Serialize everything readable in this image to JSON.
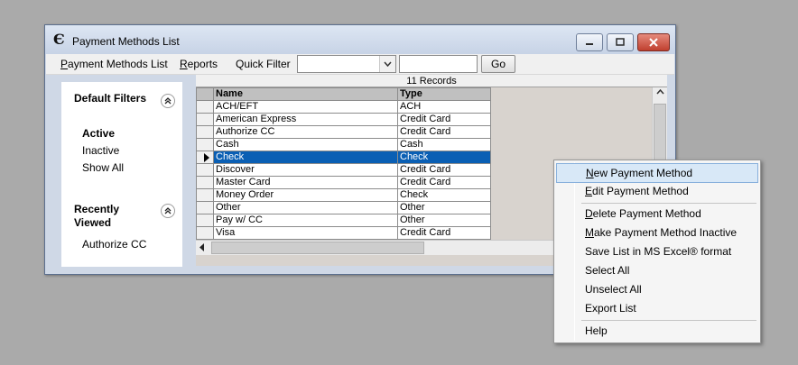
{
  "window": {
    "title": "Payment Methods List",
    "app_icon_glyph": "Є"
  },
  "menubar": {
    "items": [
      {
        "label": "Payment Methods List"
      },
      {
        "label": "Reports"
      },
      {
        "label": "Quick Filter"
      }
    ],
    "quick_filter_value": "",
    "quick_filter_text": "",
    "go_label": "Go"
  },
  "sidebar": {
    "default_filters": {
      "heading": "Default Filters",
      "items": [
        "Active",
        "Inactive",
        "Show All"
      ],
      "selected": "Active"
    },
    "recently_viewed": {
      "heading_line1": "Recently",
      "heading_line2": "Viewed",
      "items": [
        "Authorize CC"
      ]
    }
  },
  "grid": {
    "records_label": "11 Records",
    "columns": [
      "Name",
      "Type"
    ],
    "rows": [
      {
        "name": "ACH/EFT",
        "type": "ACH"
      },
      {
        "name": "American Express",
        "type": "Credit Card"
      },
      {
        "name": "Authorize CC",
        "type": "Credit Card"
      },
      {
        "name": "Cash",
        "type": "Cash"
      },
      {
        "name": "Check",
        "type": "Check"
      },
      {
        "name": "Discover",
        "type": "Credit Card"
      },
      {
        "name": "Master Card",
        "type": "Credit Card"
      },
      {
        "name": "Money Order",
        "type": "Check"
      },
      {
        "name": "Other",
        "type": "Other"
      },
      {
        "name": "Pay w/ CC",
        "type": "Other"
      },
      {
        "name": "Visa",
        "type": "Credit Card"
      }
    ],
    "selected_row": "Check"
  },
  "context_menu": {
    "items": [
      {
        "label": "New Payment Method",
        "accel": "N",
        "rest": "ew Payment Method"
      },
      {
        "label": "Edit Payment Method",
        "accel": "E",
        "rest": "dit Payment Method"
      },
      {
        "label": "Delete Payment Method",
        "accel": "D",
        "rest": "elete Payment Method"
      },
      {
        "label": "Make Payment Method Inactive",
        "accel": "M",
        "rest": "ake Payment Method Inactive"
      },
      {
        "label": "Save List in MS Excel® format"
      },
      {
        "label": "Select All"
      },
      {
        "label": "Unselect All"
      },
      {
        "label": "Export List"
      },
      {
        "label": "Help"
      }
    ],
    "highlighted": "New Payment Method"
  },
  "colors": {
    "selection": "#0a5fb4",
    "menu_highlight": "#d8e8f7",
    "close_button": "#c0402f"
  }
}
